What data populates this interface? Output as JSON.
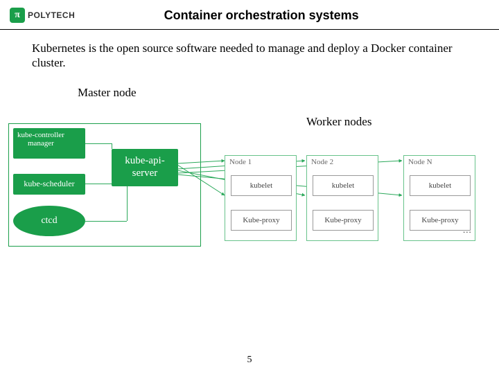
{
  "brand": {
    "badge": "π",
    "text": "POLYTECH"
  },
  "title": "Container orchestration systems",
  "intro": "Kubernetes is the open source software needed to manage and deploy a Docker container cluster.",
  "labels": {
    "master": "Master node",
    "workers": "Worker nodes"
  },
  "master": {
    "controller": "kube-controller\nmanager",
    "scheduler": "kube-scheduler",
    "etcd": "ctcd",
    "api": "kube-api-\nserver"
  },
  "nodes": [
    {
      "title": "Node 1",
      "kubelet": "kubelet",
      "proxy": "Kube-proxy"
    },
    {
      "title": "Node 2",
      "kubelet": "kubelet",
      "proxy": "Kube-proxy"
    },
    {
      "title": "Node N",
      "kubelet": "kubelet",
      "proxy": "Kube-proxy"
    }
  ],
  "ellipsis": "...",
  "page_number": "5",
  "colors": {
    "green": "#1a9e4a"
  }
}
